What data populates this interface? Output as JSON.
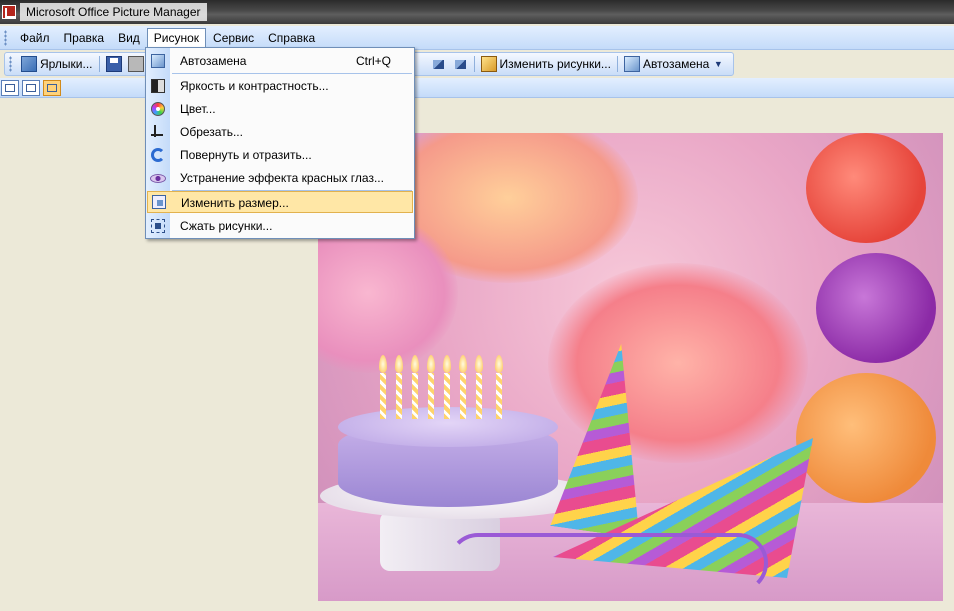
{
  "window": {
    "title": "Microsoft Office Picture Manager"
  },
  "menubar": {
    "items": [
      {
        "label": "Файл"
      },
      {
        "label": "Правка"
      },
      {
        "label": "Вид"
      },
      {
        "label": "Рисунок",
        "active": true
      },
      {
        "label": "Сервис"
      },
      {
        "label": "Справка"
      }
    ]
  },
  "toolbar": {
    "labels_button": "Ярлыки...",
    "edit_pictures_button": "Изменить рисунки...",
    "auto_correct_button": "Автозамена"
  },
  "dropdown": {
    "items": [
      {
        "label": "Автозамена",
        "shortcut": "Ctrl+Q",
        "icon": "auto-correct-icon"
      },
      {
        "label": "Яркость и контрастность...",
        "icon": "brightness-icon"
      },
      {
        "label": "Цвет...",
        "icon": "color-wheel-icon"
      },
      {
        "label": "Обрезать...",
        "icon": "crop-icon"
      },
      {
        "label": "Повернуть и отразить...",
        "icon": "rotate-icon"
      },
      {
        "label": "Устранение эффекта красных глаз...",
        "icon": "red-eye-icon"
      },
      {
        "label": "Изменить размер...",
        "icon": "resize-icon",
        "highlighted": true
      },
      {
        "label": "Сжать рисунки...",
        "icon": "compress-icon"
      }
    ]
  },
  "colors": {
    "menubar_bg": "#c4dbf9",
    "highlight": "#ffe7a6",
    "workspace_bg": "#ece9d8"
  }
}
